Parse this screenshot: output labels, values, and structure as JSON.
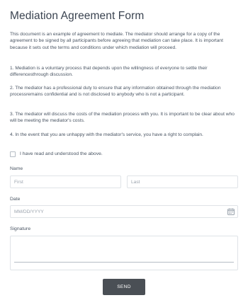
{
  "form": {
    "title": "Mediation Agreement Form",
    "intro": "This document is an example of agreement to mediate. The mediator should arrange for a copy of the agreement to be signed by all participants before agreeing that mediation can take place. It is important because it sets out the terms and conditions under which mediation will proceed.",
    "terms": [
      "1. Mediation is a voluntary process that depends upon the willingness of everyone to settle their differencesthrough discussion.",
      "2. The mediator has a professional duty to ensure that any information obtained through the mediation processremains confidential and is not disclosed to anybody who is not a participant.",
      "3. The mediator will discuss the costs of the mediation process with you. It is important to be clear about who will be meeting the mediator's costs.",
      "4. In the event that you are unhappy with the mediator's service, you have a right to complain."
    ],
    "acknowledge": {
      "label": "I have read and understood the above.",
      "checked": false
    },
    "name": {
      "label": "Name",
      "first_placeholder": "First",
      "last_placeholder": "Last",
      "first_value": "",
      "last_value": ""
    },
    "date": {
      "label": "Date",
      "placeholder": "MM/DD/YYYY",
      "value": "",
      "icon": "calendar-icon"
    },
    "signature": {
      "label": "Signature"
    },
    "submit_label": "SEND"
  },
  "colors": {
    "text": "#4a5563",
    "title": "#3a4350",
    "border": "#dfe3e7",
    "button": "#4a4f55",
    "button_text": "#ffffff"
  }
}
